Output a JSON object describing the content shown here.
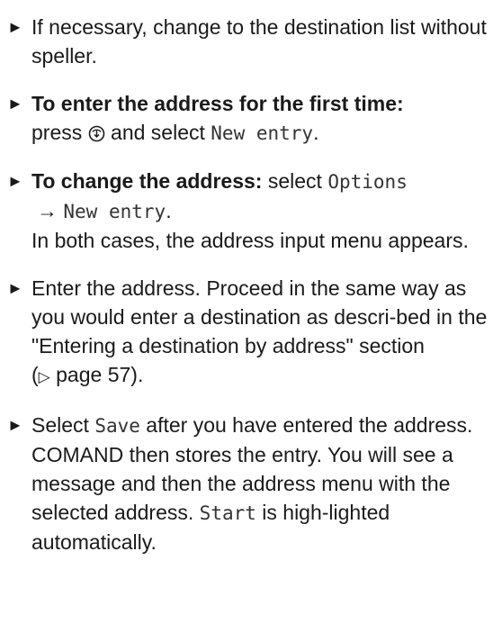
{
  "steps": [
    {
      "text": "If necessary, change to the destination list without speller."
    },
    {
      "bold": "To enter the address for the first time:",
      "press": "press",
      "icon": "knob-press-icon",
      "select_text": "and select",
      "menu_item": "New entry",
      "end": "."
    },
    {
      "bold": "To change the address:",
      "select_text": "select",
      "menu_item_1": "Options",
      "arrow": "→",
      "menu_item_2": "New entry",
      "end": ".",
      "note": "In both cases, the address input menu appears."
    },
    {
      "text_before": "Enter the address. Proceed in the same way as you would enter a destination as descri-bed in the \"Entering a destination by address\" section (",
      "ref_symbol": "▷",
      "ref_page": "page 57",
      "text_after": ")."
    },
    {
      "select_text": "Select",
      "menu_item": "Save",
      "text_1": "after you have entered the address.",
      "text_2": "COMAND then stores the entry. You will see a message and then the address menu with the selected address.",
      "menu_item_2": "Start",
      "text_3": "is high-lighted automatically."
    }
  ],
  "bullet": "►"
}
